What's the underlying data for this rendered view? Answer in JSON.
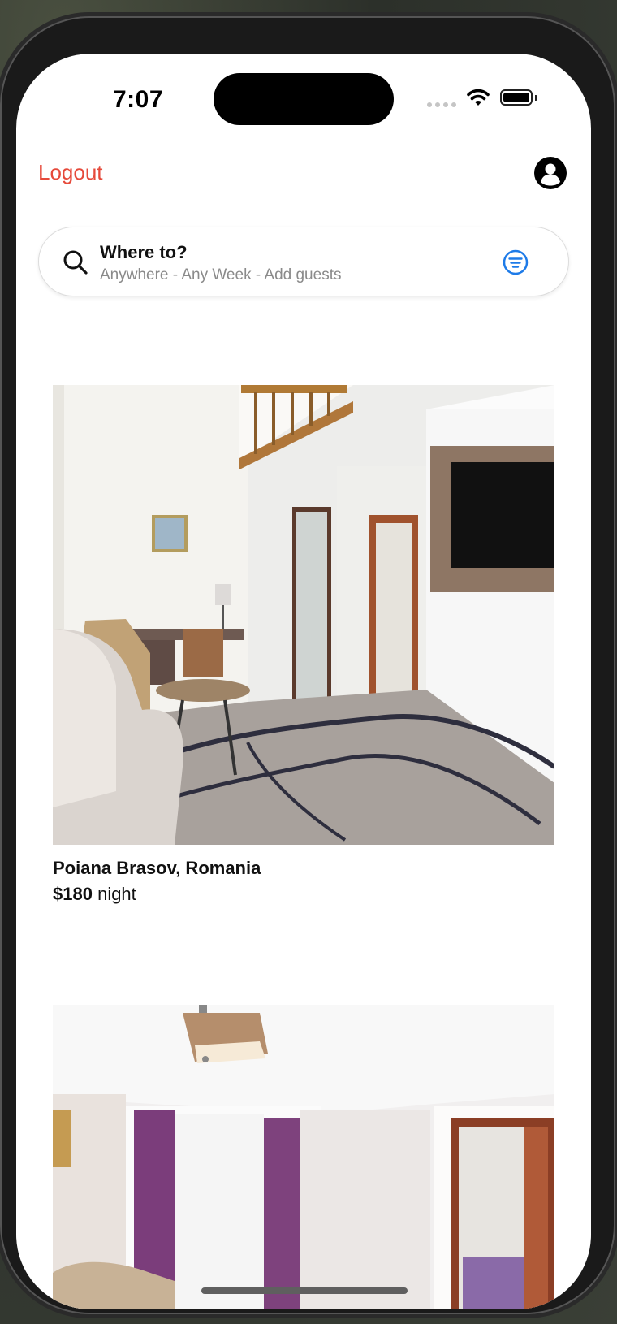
{
  "status_bar": {
    "time": "7:07"
  },
  "header": {
    "logout_label": "Logout",
    "profile_icon": "person-circle-icon"
  },
  "search": {
    "title": "Where to?",
    "subtitle": "Anywhere - Any Week - Add guests",
    "search_icon": "magnifying-glass-icon",
    "filter_icon": "filter-lines-circle-icon"
  },
  "listings": [
    {
      "location": "Poiana Brasov, Romania",
      "price": "$180",
      "price_unit": "night",
      "image": "hotel-room-living-area-photo"
    },
    {
      "location": "",
      "price": "",
      "price_unit": "",
      "image": "hotel-room-curtains-photo"
    }
  ],
  "colors": {
    "accent_red": "#E64A3B",
    "filter_blue": "#1E7BE8",
    "background": "#FFFFFF"
  }
}
